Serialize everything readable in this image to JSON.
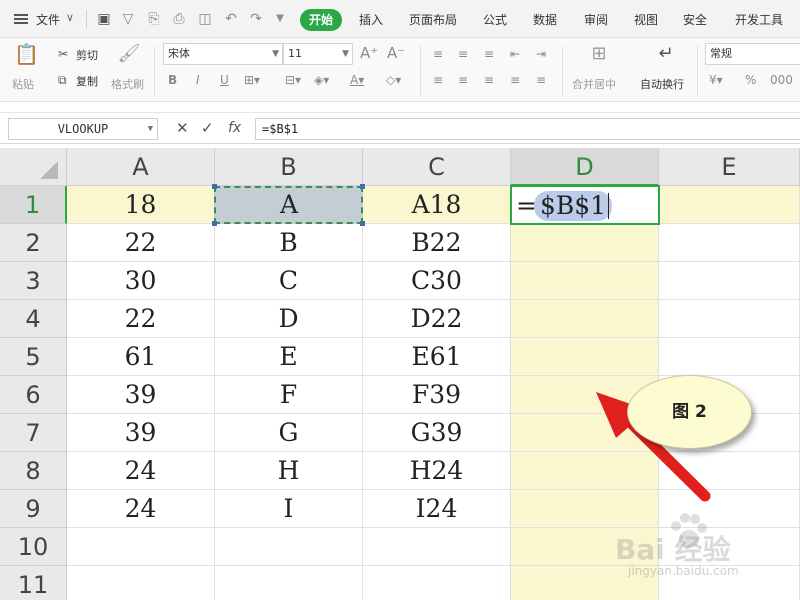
{
  "menubar": {
    "file_label": "文件",
    "tabs": [
      "开始",
      "插入",
      "页面布局",
      "公式",
      "数据",
      "审阅",
      "视图",
      "安全",
      "开发工具"
    ],
    "active_tab": "开始"
  },
  "ribbon": {
    "paste_label": "粘贴",
    "cut_label": "剪切",
    "copy_label": "复制",
    "format_painter_label": "格式刷",
    "font_name": "宋体",
    "font_size": "11",
    "merge_label": "合并居中",
    "wrap_label": "自动换行",
    "number_format": "常规"
  },
  "formula_bar": {
    "name_box": "VLOOKUP",
    "fx_label": "fx",
    "formula": "=$B$1"
  },
  "sheet": {
    "columns": [
      "A",
      "B",
      "C",
      "D",
      "E"
    ],
    "row_numbers": [
      "1",
      "2",
      "3",
      "4",
      "5",
      "6",
      "7",
      "8",
      "9",
      "10",
      "11"
    ],
    "rows": [
      {
        "a": "18",
        "b": "A",
        "c": "A18"
      },
      {
        "a": "22",
        "b": "B",
        "c": "B22"
      },
      {
        "a": "30",
        "b": "C",
        "c": "C30"
      },
      {
        "a": "22",
        "b": "D",
        "c": "D22"
      },
      {
        "a": "61",
        "b": "E",
        "c": "E61"
      },
      {
        "a": "39",
        "b": "F",
        "c": "F39"
      },
      {
        "a": "39",
        "b": "G",
        "c": "G39"
      },
      {
        "a": "24",
        "b": "H",
        "c": "H24"
      },
      {
        "a": "24",
        "b": "I",
        "c": "I24"
      }
    ],
    "active_cell": "D1",
    "edit_equals": "=",
    "edit_reference": "$B$1"
  },
  "annotation": {
    "label": "图 2",
    "arrow_color": "#e0201c"
  },
  "watermark": {
    "logo": "Bai 经验",
    "url": "jingyan.baidu.com"
  },
  "colors": {
    "accent": "#2aa845",
    "highlight": "#faf6d0",
    "reference_fill": "#bccbe8"
  }
}
